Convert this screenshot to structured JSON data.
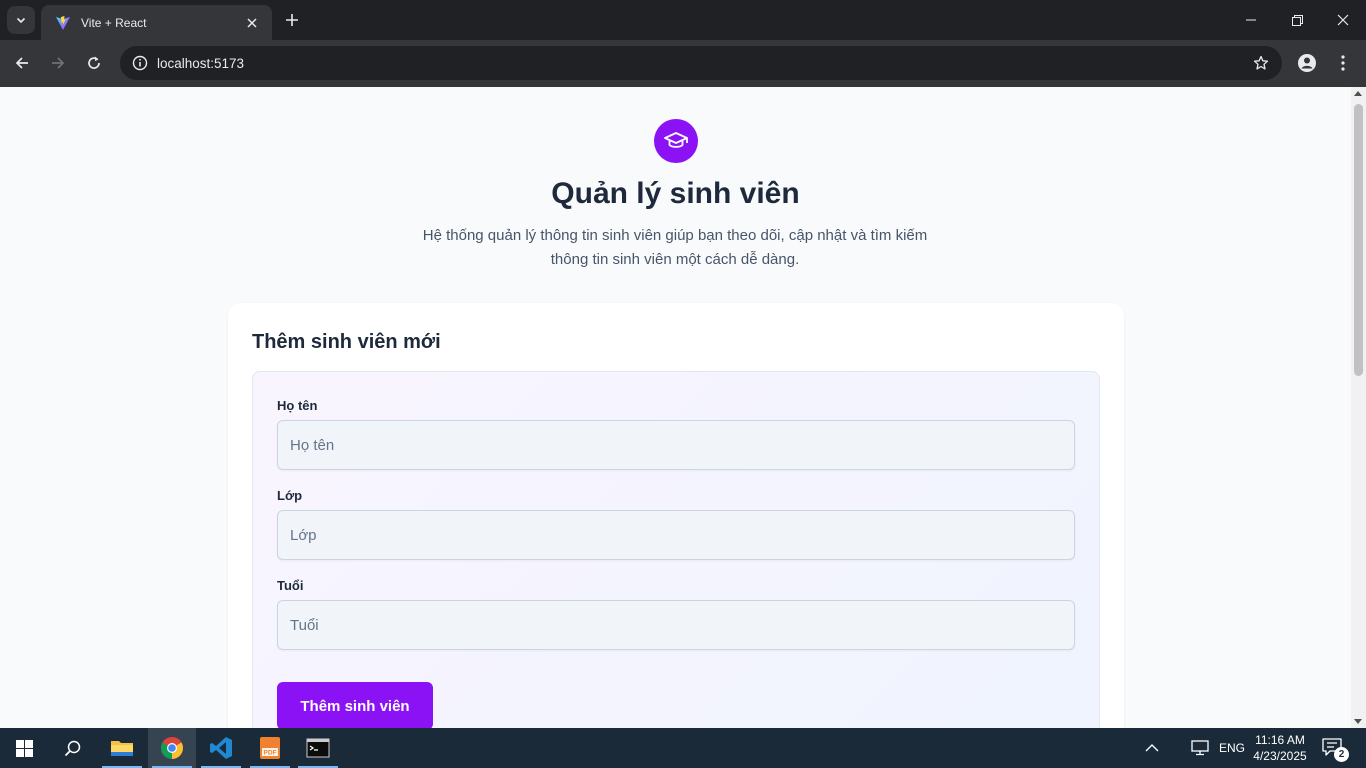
{
  "browser": {
    "tab_title": "Vite + React",
    "url": "localhost:5173"
  },
  "page": {
    "title": "Quản lý sinh viên",
    "description": "Hệ thống quản lý thông tin sinh viên giúp bạn theo dõi, cập nhật và tìm kiếm thông tin sinh viên một cách dễ dàng.",
    "form": {
      "title": "Thêm sinh viên mới",
      "fields": [
        {
          "label": "Họ tên",
          "placeholder": "Họ tên",
          "value": ""
        },
        {
          "label": "Lớp",
          "placeholder": "Lớp",
          "value": ""
        },
        {
          "label": "Tuổi",
          "placeholder": "Tuổi",
          "value": ""
        }
      ],
      "submit_label": "Thêm sinh viên"
    }
  },
  "taskbar": {
    "apps": [
      "start-icon",
      "search-icon",
      "file-explorer-icon",
      "chrome-icon",
      "vscode-icon",
      "pdf-reader-icon",
      "terminal-icon"
    ],
    "language": "ENG",
    "time": "11:16 AM",
    "date": "4/23/2025",
    "notification_count": "2"
  },
  "colors": {
    "accent": "#8b12f5",
    "page_bg": "#f8fafc",
    "title_text": "#1e293b"
  }
}
